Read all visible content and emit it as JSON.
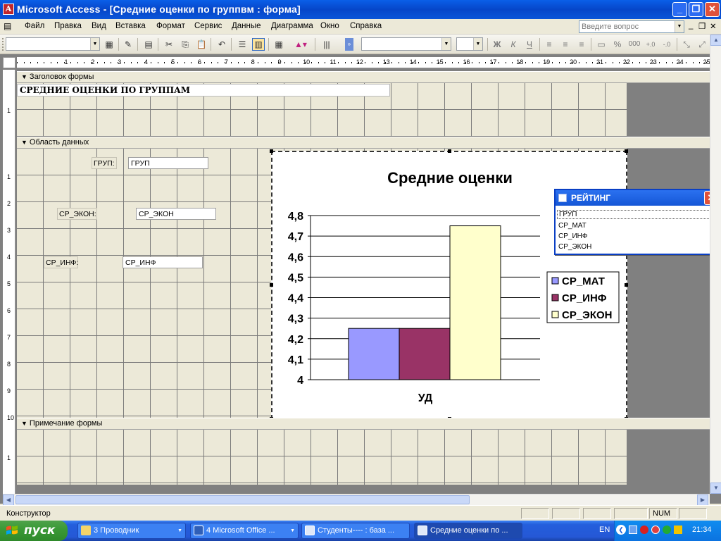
{
  "window": {
    "title": "Microsoft Access - [Средние оценки по группвм : форма]"
  },
  "menu": {
    "items": [
      "Файл",
      "Правка",
      "Вид",
      "Вставка",
      "Формат",
      "Сервис",
      "Данные",
      "Диаграмма",
      "Окно",
      "Справка"
    ],
    "help_placeholder": "Введите вопрос"
  },
  "toolbar": {
    "format_buttons": [
      "Ж",
      "К",
      "Ч"
    ],
    "percent": "%",
    "thousands": "000"
  },
  "ruler": {
    "top": [
      "1",
      "2",
      "3",
      "4",
      "5",
      "6",
      "7",
      "8",
      "9",
      "10",
      "11",
      "12",
      "13",
      "14",
      "15",
      "16",
      "17",
      "18",
      "19",
      "20",
      "21",
      "22",
      "23",
      "24",
      "25"
    ],
    "left_header": [
      "1"
    ],
    "left_data": [
      "1",
      "2",
      "3",
      "4",
      "5",
      "6",
      "7",
      "8",
      "9",
      "10"
    ],
    "left_footer": [
      "1"
    ]
  },
  "sections": {
    "header": "Заголовок формы",
    "detail": "Область данных",
    "footer": "Примечание формы"
  },
  "form": {
    "title": "СРЕДНИЕ ОЦЕНКИ ПО ГРУППАМ",
    "controls": [
      {
        "label": "ГРУП:",
        "field": "ГРУП"
      },
      {
        "label": "СР_ЭКОН:",
        "field": "СР_ЭКОН"
      },
      {
        "label": "СР_ИНФ:",
        "field": "СР_ИНФ"
      }
    ]
  },
  "chart_data": {
    "type": "bar",
    "title": "Средние оценки",
    "categories": [
      "УД"
    ],
    "series": [
      {
        "name": "СР_МАТ",
        "values": [
          4.25
        ],
        "color": "#9999ff"
      },
      {
        "name": "СР_ИНФ",
        "values": [
          4.25
        ],
        "color": "#993366"
      },
      {
        "name": "СР_ЭКОН",
        "values": [
          4.75
        ],
        "color": "#ffffcc"
      }
    ],
    "ylim": [
      4,
      4.8
    ],
    "yticks": [
      "4",
      "4,1",
      "4,2",
      "4,3",
      "4,4",
      "4,5",
      "4,6",
      "4,7",
      "4,8"
    ],
    "grid": true,
    "legend": "right"
  },
  "field_list": {
    "title": "РЕЙТИНГ",
    "items": [
      "ГРУП",
      "СР_МАТ",
      "СР_ИНФ",
      "СР_ЭКОН"
    ]
  },
  "status": {
    "mode": "Конструктор",
    "num": "NUM"
  },
  "taskbar": {
    "start": "пуск",
    "tasks": [
      "3 Проводник",
      "4 Microsoft Office ...",
      "Студенты---- : база ...",
      "Средние оценки по ..."
    ],
    "lang": "EN",
    "clock": "21:34"
  }
}
